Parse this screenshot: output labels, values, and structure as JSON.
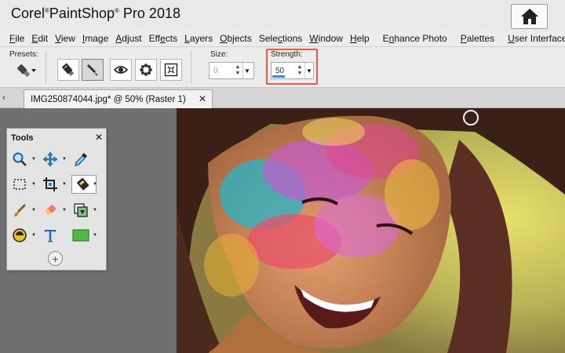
{
  "app": {
    "title_prefix": "Corel",
    "title_mark": "®",
    "title_name": "PaintShop",
    "title_suffix": "Pro 2018"
  },
  "menu": {
    "items": [
      {
        "key": "F",
        "rest": "ile"
      },
      {
        "key": "E",
        "rest": "dit"
      },
      {
        "key": "V",
        "rest": "iew"
      },
      {
        "key": "I",
        "rest": "mage"
      },
      {
        "key": "A",
        "rest": "djust"
      },
      {
        "pre": "Eff",
        "key": "e",
        "rest": "cts"
      },
      {
        "key": "L",
        "rest": "ayers"
      },
      {
        "key": "O",
        "rest": "bjects"
      },
      {
        "pre": "Sele",
        "key": "c",
        "rest": "tions"
      },
      {
        "key": "W",
        "rest": "indow"
      },
      {
        "key": "H",
        "rest": "elp"
      }
    ],
    "extra": [
      {
        "pre": "E",
        "key": "n",
        "rest": "hance Photo"
      },
      {
        "key": "P",
        "rest": "alettes"
      },
      {
        "key": "U",
        "rest": "ser Interface"
      }
    ]
  },
  "options": {
    "presets_label": "Presets:",
    "size_label": "Size:",
    "size_value": "0",
    "strength_label": "Strength:",
    "strength_value": "50",
    "strength_level_percent": 50,
    "highlight_color": "#f05a3c",
    "tool_buttons": [
      "smart-carver-icon",
      "brush-stroke-icon",
      "eye-icon",
      "flower-icon",
      "spot-removal-icon"
    ]
  },
  "document": {
    "tab_label": "IMG250874044.jpg*  @  50% (Raster 1)",
    "close_glyph": "✕",
    "scroll_glyph": "‹"
  },
  "tools_palette": {
    "title": "Tools",
    "close_glyph": "✕",
    "add_glyph": "+",
    "tools": [
      "zoom-icon",
      "pan-icon",
      "dropper-icon",
      "selection-icon",
      "crop-icon",
      "makeover-icon",
      "paint-brush-icon",
      "eraser-icon",
      "clone-icon",
      "fill-icon",
      "text-icon",
      "rectangle-icon"
    ]
  },
  "colors": {
    "accent_highlight": "#f05a3c",
    "workspace": "#6f6f6f",
    "rectangle_tool": "#52b848"
  }
}
